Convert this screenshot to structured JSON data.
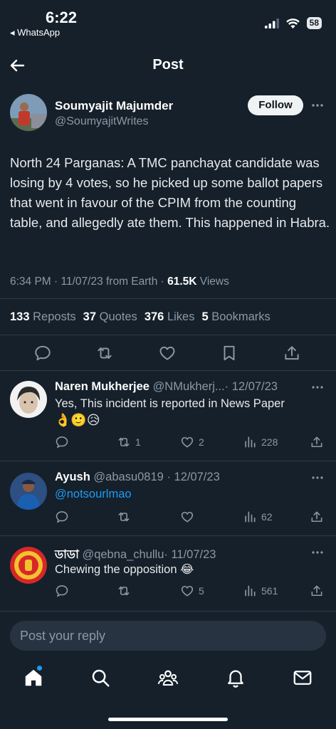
{
  "status_bar": {
    "time": "6:22",
    "back_app": "◂ WhatsApp",
    "battery": "58"
  },
  "header": {
    "title": "Post"
  },
  "author": {
    "name": "Soumyajit Majumder",
    "handle": "@SoumyajitWrites",
    "follow_label": "Follow"
  },
  "post": {
    "text": "North 24 Parganas: A TMC panchayat candidate was losing by 4 votes, so he picked up some ballot papers that went in favour of the CPIM from the counting table, and allegedly ate them. This happened in Habra.",
    "meta_time": "6:34 PM · 11/07/23 from Earth · ",
    "views_count": "61.5K",
    "views_label": " Views"
  },
  "stats": {
    "reposts_count": "133",
    "reposts_label": "Reposts",
    "quotes_count": "37",
    "quotes_label": "Quotes",
    "likes_count": "376",
    "likes_label": "Likes",
    "bookmarks_count": "5",
    "bookmarks_label": "Bookmarks"
  },
  "icons": {
    "actions": [
      "reply-icon",
      "repost-icon",
      "like-icon",
      "bookmark-icon",
      "share-icon"
    ],
    "nav": [
      "home-icon",
      "search-icon",
      "communities-icon",
      "notifications-icon",
      "messages-icon"
    ]
  },
  "colors": {
    "background": "#15202b",
    "accent": "#1d9bf0",
    "text": "#e7e9ea",
    "muted": "#8b98a5"
  },
  "replies": [
    {
      "name": "Naren Mukherjee",
      "handle": "@NMukherj...",
      "date": "· 12/07/23",
      "text": "Yes, This incident is reported in News Paper",
      "emojis": "👌🙂😥",
      "reply_count": "",
      "repost_count": "1",
      "like_count": "2",
      "view_count": "228"
    },
    {
      "name": "Ayush",
      "handle": "@abasu0819",
      "date": "· 12/07/23",
      "text": "@notsourlmao",
      "emojis": "",
      "reply_count": "",
      "repost_count": "",
      "like_count": "",
      "view_count": "62"
    },
    {
      "name": "ডাডা",
      "handle": "@qebna_chullu",
      "date": "· 11/07/23",
      "text": "Chewing the opposition",
      "emojis": "😂",
      "reply_count": "",
      "repost_count": "",
      "like_count": "5",
      "view_count": "561"
    }
  ],
  "reply_box": {
    "placeholder": "Post your reply"
  }
}
